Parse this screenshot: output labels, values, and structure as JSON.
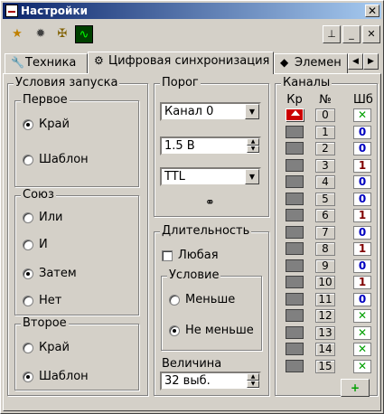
{
  "window": {
    "title": "Настройки",
    "close": "✕"
  },
  "toolbar": {
    "icons": [
      "star-folder-icon",
      "gear-icon",
      "cross-icon",
      "signal-icon"
    ],
    "right": [
      "pin-icon",
      "minimize-icon",
      "close-icon"
    ]
  },
  "tabs": [
    {
      "label": "Техника",
      "icon": "wrench-icon"
    },
    {
      "label": "Цифровая синхронизация",
      "icon": "sync-icon",
      "active": true
    },
    {
      "label": "Элемен",
      "icon": "element-icon"
    }
  ],
  "trigger": {
    "title": "Условия запуска",
    "first": {
      "title": "Первое",
      "options": [
        "Край",
        "Шаблон"
      ],
      "selected": 0
    },
    "union": {
      "title": "Союз",
      "options": [
        "Или",
        "И",
        "Затем",
        "Нет"
      ],
      "selected": 2
    },
    "second": {
      "title": "Второе",
      "options": [
        "Край",
        "Шаблон"
      ],
      "selected": 1
    }
  },
  "threshold": {
    "title": "Порог",
    "channel": "Канал 0",
    "voltage": "1.5 В",
    "logic": "TTL",
    "binoculars": "binoculars-icon"
  },
  "duration": {
    "title": "Длительность",
    "any_label": "Любая",
    "condition": {
      "title": "Условие",
      "options": [
        "Меньше",
        "Не меньше"
      ],
      "selected": 1
    },
    "value_label": "Величина",
    "value": "32 выб."
  },
  "channels": {
    "title": "Каналы",
    "col_kr": "Кр",
    "col_num": "№",
    "col_sh": "Шб",
    "rows": [
      {
        "n": "0",
        "s": "✕",
        "c": "green",
        "active": true
      },
      {
        "n": "1",
        "s": "0",
        "c": "blue"
      },
      {
        "n": "2",
        "s": "0",
        "c": "blue"
      },
      {
        "n": "3",
        "s": "1",
        "c": "red"
      },
      {
        "n": "4",
        "s": "0",
        "c": "blue"
      },
      {
        "n": "5",
        "s": "0",
        "c": "blue"
      },
      {
        "n": "6",
        "s": "1",
        "c": "red"
      },
      {
        "n": "7",
        "s": "0",
        "c": "blue"
      },
      {
        "n": "8",
        "s": "1",
        "c": "red"
      },
      {
        "n": "9",
        "s": "0",
        "c": "blue"
      },
      {
        "n": "10",
        "s": "1",
        "c": "red"
      },
      {
        "n": "11",
        "s": "0",
        "c": "blue"
      },
      {
        "n": "12",
        "s": "✕",
        "c": "green"
      },
      {
        "n": "13",
        "s": "✕",
        "c": "green"
      },
      {
        "n": "14",
        "s": "✕",
        "c": "green"
      },
      {
        "n": "15",
        "s": "✕",
        "c": "green"
      }
    ],
    "add_label": "+"
  }
}
